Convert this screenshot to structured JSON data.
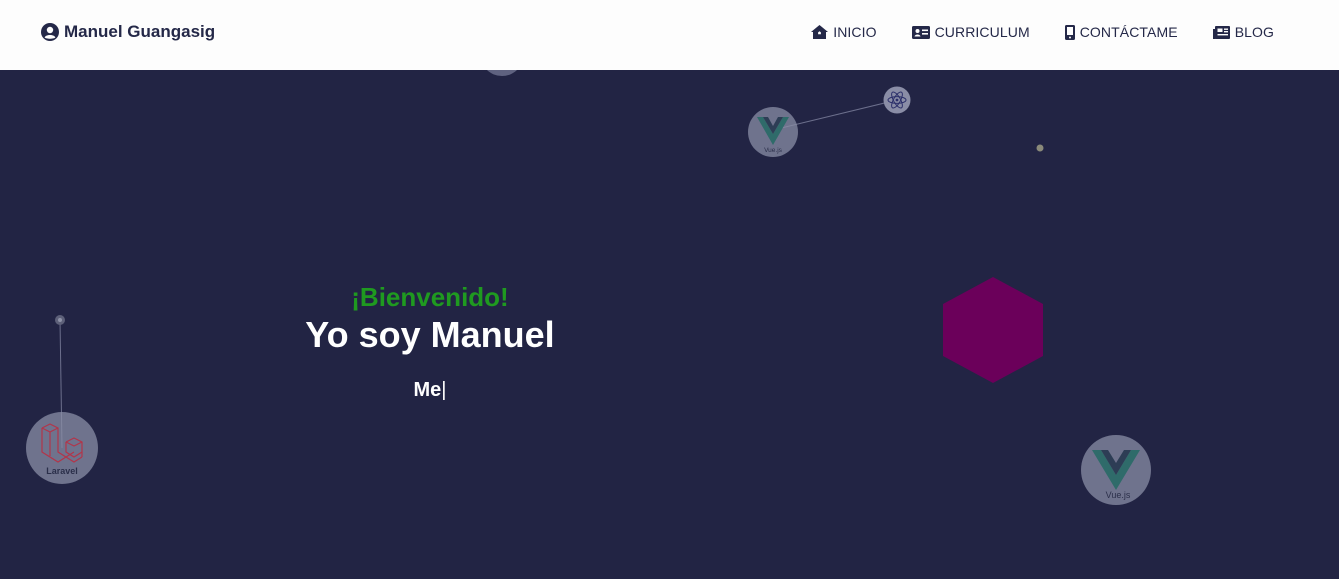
{
  "brand": {
    "name": "Manuel Guangasig",
    "icon": "user-circle-icon"
  },
  "nav": [
    {
      "label": "INICIO",
      "icon": "home-icon"
    },
    {
      "label": "CURRICULUM",
      "icon": "id-card-icon"
    },
    {
      "label": "CONTÁCTAME",
      "icon": "mobile-phone-icon"
    },
    {
      "label": "BLOG",
      "icon": "newspaper-icon"
    }
  ],
  "hero": {
    "greeting": "¡Bienvenido!",
    "title": "Yo soy Manuel",
    "typed_text": "Me",
    "cursor": "|"
  },
  "particles": {
    "laravel_label": "Laravel",
    "vue_label": "Vue.js"
  },
  "colors": {
    "background": "#222444",
    "navbar": "#fdfdfd",
    "greeting": "#1f9a20",
    "hexagon": "#6b005a"
  }
}
